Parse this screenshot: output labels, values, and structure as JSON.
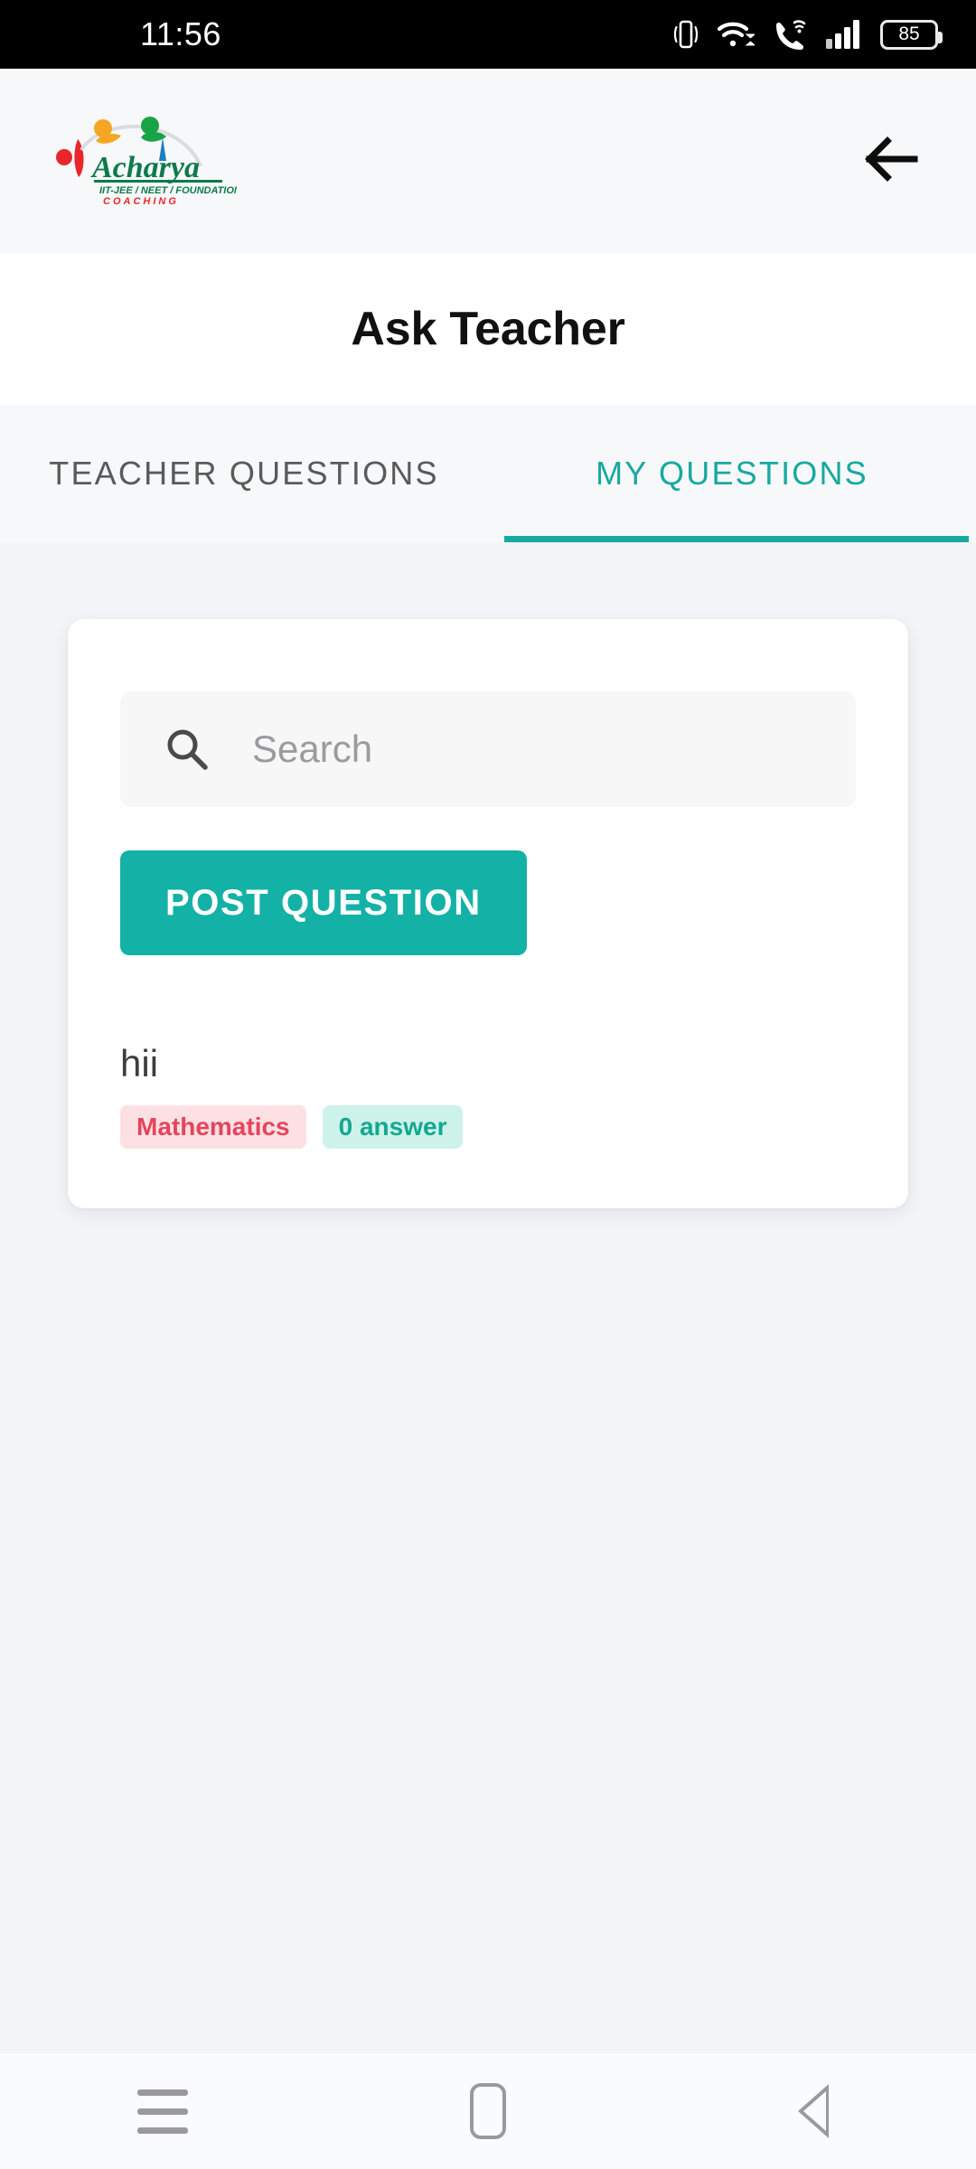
{
  "status_bar": {
    "time": "11:56",
    "battery_level": "85",
    "icons": [
      "vibrate-icon",
      "wifi-icon",
      "wifi-calling-icon",
      "signal-icon",
      "battery-icon"
    ]
  },
  "header": {
    "logo": {
      "brand": "Acharya",
      "tagline": "IIT-JEE / NEET / FOUNDATION",
      "subtagline": "COACHING"
    },
    "back_icon": "arrow-left-icon"
  },
  "page": {
    "title": "Ask Teacher"
  },
  "tabs": [
    {
      "label": "TEACHER QUESTIONS",
      "active": false
    },
    {
      "label": "MY QUESTIONS",
      "active": true
    }
  ],
  "search": {
    "placeholder": "Search",
    "value": "",
    "icon": "search-icon"
  },
  "actions": {
    "post_question_label": "POST QUESTION"
  },
  "questions": [
    {
      "text": "hii",
      "subject": "Mathematics",
      "answers": "0 answer"
    }
  ],
  "nav_bar": {
    "recents_label": "Recents",
    "home_label": "Home",
    "back_label": "Back"
  },
  "colors": {
    "accent_teal": "#14b1a6",
    "tab_active": "#17a9a0",
    "tag_subject_bg": "#fde0e3",
    "tag_subject_fg": "#e4455c",
    "tag_answers_bg": "#cdf2ea",
    "tag_answers_fg": "#13a890",
    "page_bg": "#f2f4f7"
  }
}
